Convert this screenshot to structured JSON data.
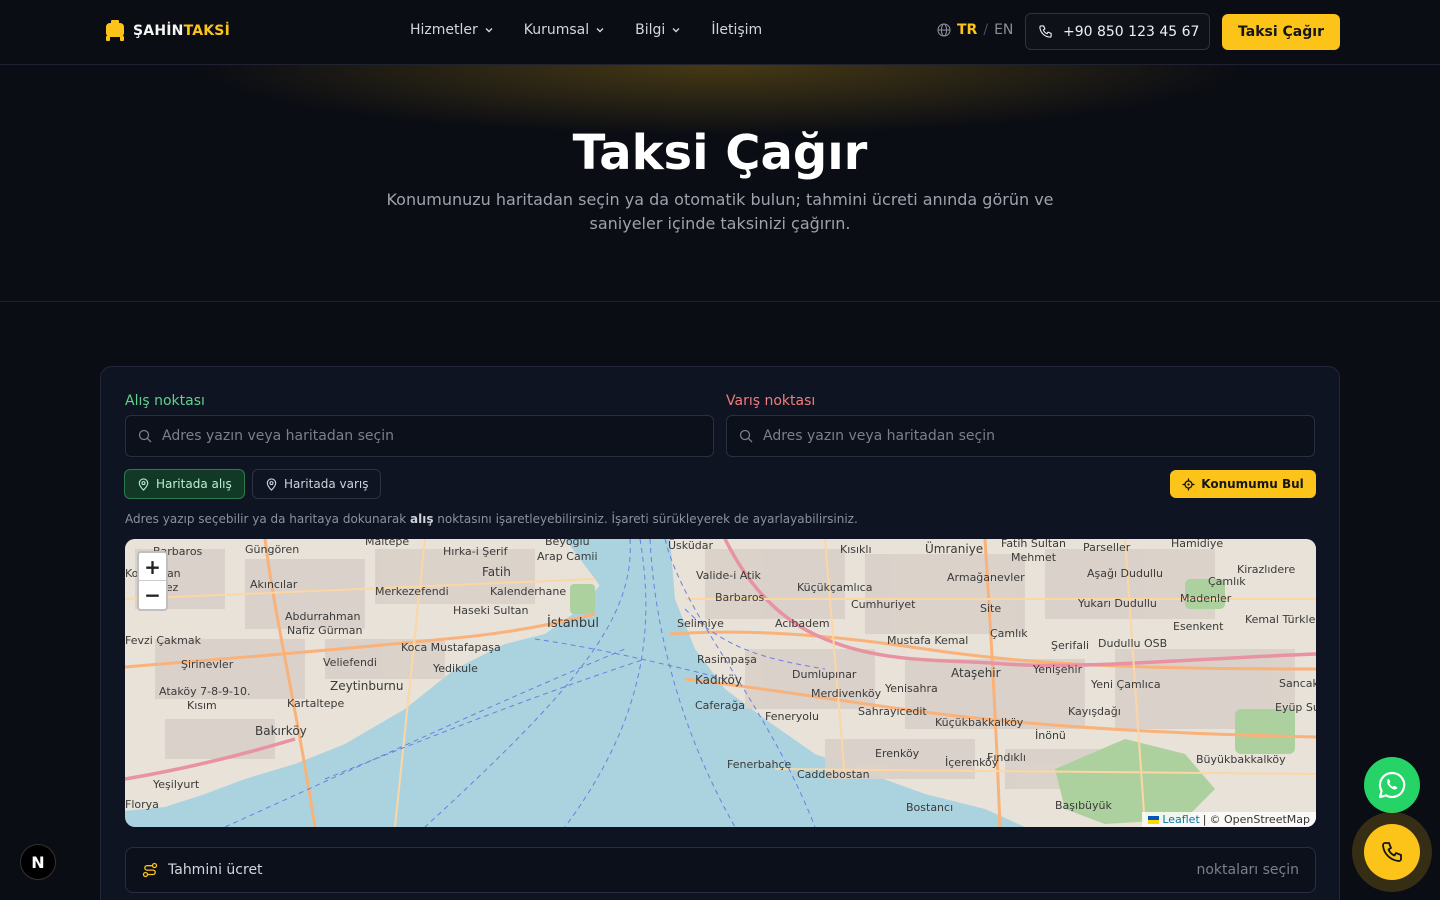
{
  "brand": {
    "part1": "ŞAHİN",
    "part2": "TAKSİ"
  },
  "nav": [
    {
      "label": "Hizmetler",
      "has_menu": true
    },
    {
      "label": "Kurumsal",
      "has_menu": true
    },
    {
      "label": "Bilgi",
      "has_menu": true
    },
    {
      "label": "İletişim",
      "has_menu": false
    }
  ],
  "lang": {
    "active": "TR",
    "separator": "/",
    "other": "EN"
  },
  "header": {
    "phone": "+90 850 123 45 67",
    "cta": "Taksi Çağır"
  },
  "hero": {
    "title": "Taksi Çağır",
    "subtitle": "Konumunuzu haritadan seçin ya da otomatik bulun; tahmini ücreti anında görün ve saniyeler içinde taksinizi çağırın."
  },
  "form": {
    "pickup_label": "Alış noktası",
    "dropoff_label": "Varış noktası",
    "pickup_placeholder": "Adres yazın veya haritadan seçin",
    "dropoff_placeholder": "Adres yazın veya haritadan seçin",
    "pickup_chip": "Haritada alış",
    "dropoff_chip": "Haritada varış",
    "find_location": "Konumumu Bul",
    "hint_before": "Adres yazıp seçebilir ya da haritaya dokunarak ",
    "hint_bold": "alış",
    "hint_after": " noktasını işaretleyebilirsiniz. İşareti sürükleyerek de ayarlayabilirsiniz."
  },
  "map": {
    "zoom_in": "+",
    "zoom_out": "−",
    "attribution_leaflet": "Leaflet",
    "attribution_sep": "|",
    "attribution_osm": "© OpenStreetMap",
    "labels": [
      "Barbaros",
      "Güngören",
      "Maltepe",
      "Hırka-i Şerif",
      "Arap Camii",
      "Beyoğlu",
      "Üsküdar",
      "Kısıklı",
      "Ümraniye",
      "Fatih Sultan Mehmet",
      "Parseller",
      "Hamidiye",
      "Kocasinan Merkez",
      "Akıncılar",
      "Merkezefendi",
      "Fatih",
      "Kalenderhane",
      "Valide-i Atik",
      "Küçükçamlıca",
      "Armağanevler",
      "Aşağı Dudullu",
      "Çamlık",
      "Kirazlıdere",
      "Abdurrahman Nafiz Gürman",
      "Haseki Sultan",
      "İstanbul",
      "Barbaros",
      "Cumhuriyet",
      "Site",
      "Yukarı Dudullu",
      "Madenler",
      "Fevzi Çakmak",
      "Koca Mustafapaşa",
      "Selimiye",
      "Acıbadem",
      "Mustafa Kemal",
      "Çamlık",
      "Şerifali",
      "Dudullu OSB",
      "Esenkent",
      "Kemal Türkler",
      "Şirinevler",
      "Velieefendi",
      "Yedikule",
      "Rasimpaşa",
      "Dumlupınar",
      "Ataşehir",
      "Yenişehir",
      "Yeni Çamlıca",
      "Sancak",
      "Zeytinburnu",
      "Ataköy 7-8-9-10. Kısım",
      "Kadıköy",
      "Merdivenköy",
      "Yenisahra",
      "Kartaltepe",
      "Caferağa",
      "Feneryolu",
      "Sahrayıcedit",
      "Küçükbakkalköy",
      "Kayışdağı",
      "Eyüp Sultan",
      "Bakırköy",
      "İnönü",
      "Erenköy",
      "Fındıklı",
      "Büyükbakkalköy",
      "Fenerbahçe",
      "Caddebostan",
      "İçerenköy",
      "Yeşilyurt",
      "Bostancı",
      "Başıbüyük",
      "Florya"
    ]
  },
  "fare": {
    "label": "Tahmini ücret",
    "value": "noktaları seçin"
  },
  "badge": "N"
}
